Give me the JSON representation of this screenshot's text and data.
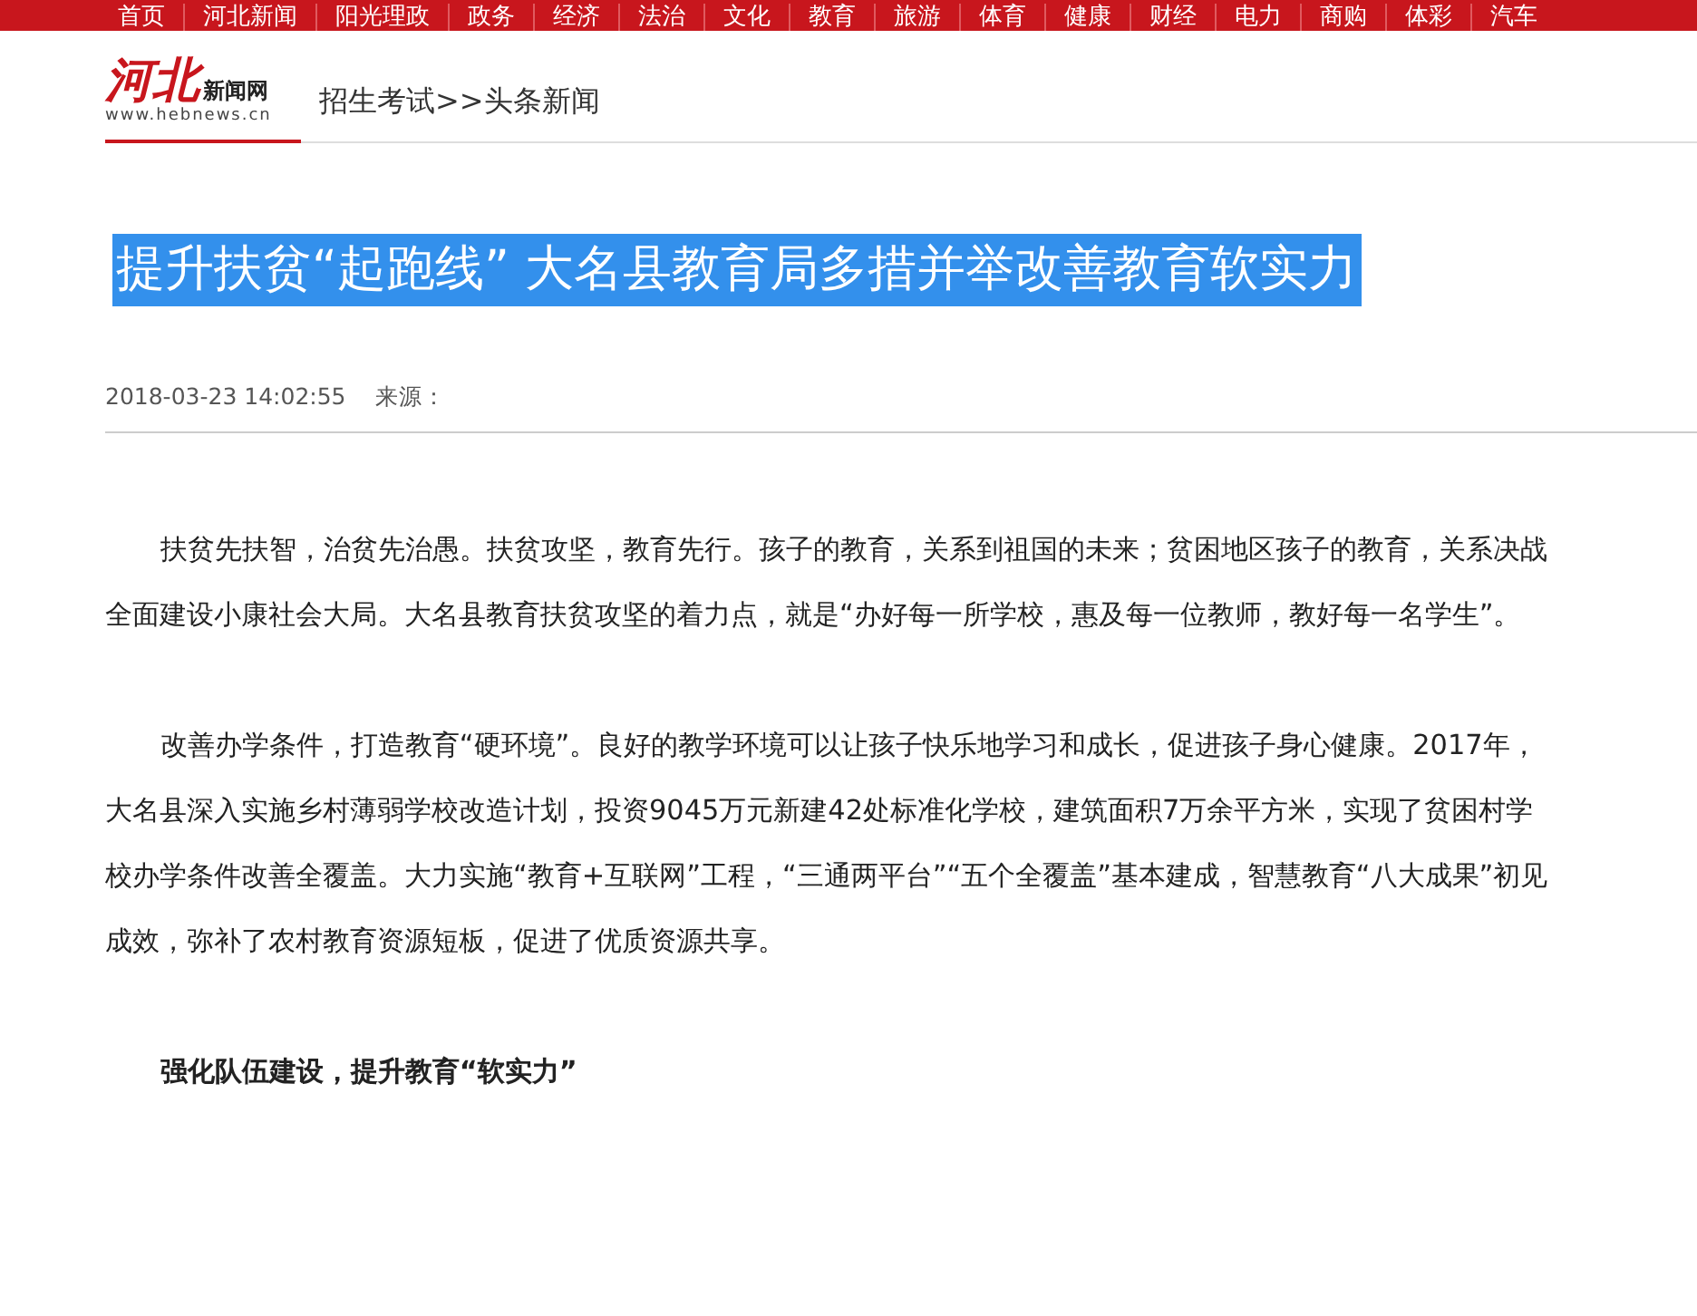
{
  "nav": [
    {
      "label": "首页"
    },
    {
      "label": "河北新闻"
    },
    {
      "label": "阳光理政"
    },
    {
      "label": "政务"
    },
    {
      "label": "经济"
    },
    {
      "label": "法治"
    },
    {
      "label": "文化"
    },
    {
      "label": "教育"
    },
    {
      "label": "旅游"
    },
    {
      "label": "体育"
    },
    {
      "label": "健康"
    },
    {
      "label": "财经"
    },
    {
      "label": "电力"
    },
    {
      "label": "商购"
    },
    {
      "label": "体彩"
    },
    {
      "label": "汽车"
    }
  ],
  "logo": {
    "mark": "河北",
    "name": "新闻网",
    "url": "www.hebnews.cn"
  },
  "breadcrumb": "招生考试>>头条新闻",
  "article": {
    "title": "提升扶贫“起跑线” 大名县教育局多措并举改善教育软实力",
    "title_selected": true,
    "date": "2018-03-23 14:02:55",
    "source_label": "来源：",
    "paragraphs": [
      {
        "kind": "text",
        "text": "扶贫先扶智，治贫先治愚。扶贫攻坚，教育先行。孩子的教育，关系到祖国的未来；贫困地区孩子的教育，关系决战全面建设小康社会大局。大名县教育扶贫攻坚的着力点，就是“办好每一所学校，惠及每一位教师，教好每一名学生”。"
      },
      {
        "kind": "text",
        "text": "改善办学条件，打造教育“硬环境”。良好的教学环境可以让孩子快乐地学习和成长，促进孩子身心健康。2017年，大名县深入实施乡村薄弱学校改造计划，投资9045万元新建42处标准化学校，建筑面积7万余平方米，实现了贫困村学校办学条件改善全覆盖。大力实施“教育+互联网”工程，“三通两平台”“五个全覆盖”基本建成，智慧教育“八大成果”初见成效，弥补了农村教育资源短板，促进了优质资源共享。"
      },
      {
        "kind": "heading",
        "text": "强化队伍建设，提升教育“软实力”"
      }
    ]
  }
}
